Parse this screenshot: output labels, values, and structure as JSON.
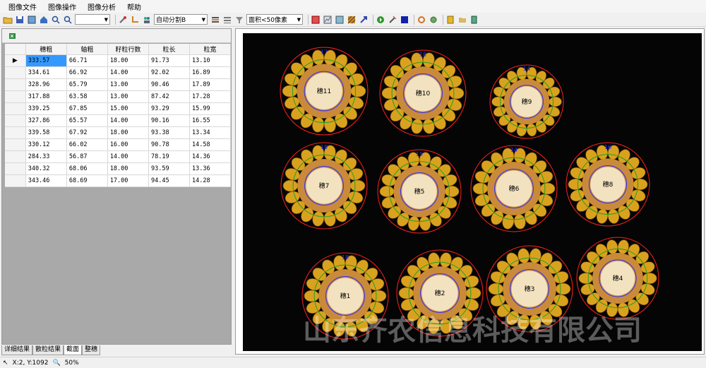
{
  "menu": [
    "图像文件",
    "图像操作",
    "图像分析",
    "帮助"
  ],
  "toolbar": {
    "combo1": "",
    "segment_mode": "自动分割B",
    "area_filter": "面积<50像素"
  },
  "table": {
    "columns": [
      "穗粗",
      "轴粗",
      "籽粒行数",
      "粒长",
      "粒宽"
    ],
    "rows": [
      [
        "333.57",
        "66.71",
        "18.00",
        "91.73",
        "13.10"
      ],
      [
        "334.61",
        "66.92",
        "14.00",
        "92.02",
        "16.89"
      ],
      [
        "328.96",
        "65.79",
        "13.00",
        "90.46",
        "17.89"
      ],
      [
        "317.88",
        "63.58",
        "13.00",
        "87.42",
        "17.28"
      ],
      [
        "339.25",
        "67.85",
        "15.00",
        "93.29",
        "15.99"
      ],
      [
        "327.86",
        "65.57",
        "14.00",
        "90.16",
        "16.55"
      ],
      [
        "339.58",
        "67.92",
        "18.00",
        "93.38",
        "13.34"
      ],
      [
        "330.12",
        "66.02",
        "16.00",
        "90.78",
        "14.58"
      ],
      [
        "284.33",
        "56.87",
        "14.00",
        "78.19",
        "14.36"
      ],
      [
        "340.32",
        "68.06",
        "18.00",
        "93.59",
        "13.36"
      ],
      [
        "343.46",
        "68.69",
        "17.00",
        "94.45",
        "14.28"
      ]
    ]
  },
  "tabs": [
    "详细结果",
    "散粒结果",
    "截面",
    "整穗"
  ],
  "active_tab": "截面",
  "status": {
    "coords": "X:2, Y:1092",
    "zoom": "50%"
  },
  "watermark": "山东齐农信息科技有限公司",
  "ears": [
    {
      "label": "穗11",
      "top_num": "17"
    },
    {
      "label": "穗10",
      "top_num": "18"
    },
    {
      "label": "穗9",
      "top_num": "14"
    },
    {
      "label": "穗7",
      "top_num": "18"
    },
    {
      "label": "穗5",
      "top_num": "15"
    },
    {
      "label": "穗6",
      "top_num": "14"
    },
    {
      "label": "穗8",
      "top_num": "16"
    },
    {
      "label": "穗1",
      "top_num": "18"
    },
    {
      "label": "穗2",
      "top_num": ""
    },
    {
      "label": "穗3",
      "top_num": ""
    },
    {
      "label": "穗4",
      "top_num": ""
    }
  ],
  "colors": {
    "kernel": "#d9a21e",
    "red_ring": "#ff2020",
    "green_ring": "#22a022",
    "blue_ring": "#3030ff",
    "selection": "#3399ff"
  }
}
